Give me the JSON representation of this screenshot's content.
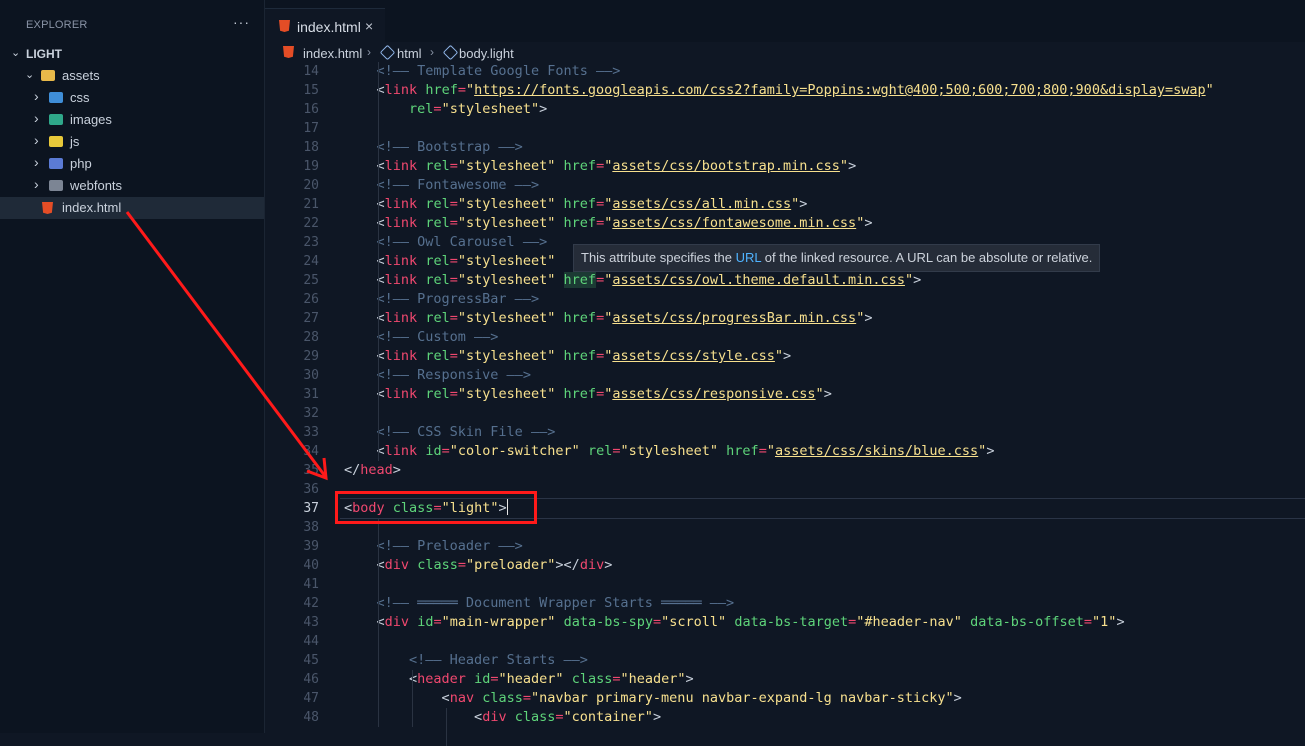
{
  "explorer": {
    "header": "EXPLORER",
    "more": "···",
    "root": "LIGHT",
    "items": [
      {
        "label": "assets",
        "type": "folder-open",
        "depth": 1,
        "chevron": "⌄"
      },
      {
        "label": "css",
        "type": "folder",
        "depth": 2,
        "chevron": "›"
      },
      {
        "label": "images",
        "type": "folder",
        "depth": 2,
        "chevron": "›"
      },
      {
        "label": "js",
        "type": "folder",
        "depth": 2,
        "chevron": "›"
      },
      {
        "label": "php",
        "type": "folder",
        "depth": 2,
        "chevron": "›"
      },
      {
        "label": "webfonts",
        "type": "folder",
        "depth": 2,
        "chevron": "›"
      },
      {
        "label": "index.html",
        "type": "html-file",
        "depth": 1,
        "selected": true
      }
    ]
  },
  "tab": {
    "title": "index.html",
    "close": "×"
  },
  "breadcrumb": {
    "file": "index.html",
    "sep": "›",
    "node1": "html",
    "node2": "body.light"
  },
  "tooltip": {
    "pre": "This attribute specifies the ",
    "link": "URL",
    "post": " of the linked resource. A URL can be absolute or relative."
  },
  "colors": {
    "annotation": "#ff1a1a",
    "background": "#0f1724",
    "tag": "#f0486f",
    "attr": "#5ed47a",
    "string": "#f7e08e",
    "comment": "#56708f"
  },
  "editor": {
    "active_line": 37,
    "lines": [
      {
        "n": "14",
        "t": "    <!—— Template Google Fonts ——>"
      },
      {
        "n": "15",
        "t": "    <link href=\"https://fonts.googleapis.com/css2?family=Poppins:wght@400;500;600;700;800;900&display=swap\""
      },
      {
        "n": "16",
        "t": "        rel=\"stylesheet\">"
      },
      {
        "n": "17",
        "t": ""
      },
      {
        "n": "18",
        "t": "    <!—— Bootstrap ——>"
      },
      {
        "n": "19",
        "t": "    <link rel=\"stylesheet\" href=\"assets/css/bootstrap.min.css\">"
      },
      {
        "n": "20",
        "t": "    <!—— Fontawesome ——>"
      },
      {
        "n": "21",
        "t": "    <link rel=\"stylesheet\" href=\"assets/css/all.min.css\">"
      },
      {
        "n": "22",
        "t": "    <link rel=\"stylesheet\" href=\"assets/css/fontawesome.min.css\">"
      },
      {
        "n": "23",
        "t": "    <!—— Owl Carousel ——>"
      },
      {
        "n": "24",
        "t": "    <link rel=\"stylesheet\""
      },
      {
        "n": "25",
        "t": "    <link rel=\"stylesheet\" href=\"assets/css/owl.theme.default.min.css\">"
      },
      {
        "n": "26",
        "t": "    <!—— ProgressBar ——>"
      },
      {
        "n": "27",
        "t": "    <link rel=\"stylesheet\" href=\"assets/css/progressBar.min.css\">"
      },
      {
        "n": "28",
        "t": "    <!—— Custom ——>"
      },
      {
        "n": "29",
        "t": "    <link rel=\"stylesheet\" href=\"assets/css/style.css\">"
      },
      {
        "n": "30",
        "t": "    <!—— Responsive ——>"
      },
      {
        "n": "31",
        "t": "    <link rel=\"stylesheet\" href=\"assets/css/responsive.css\">"
      },
      {
        "n": "32",
        "t": ""
      },
      {
        "n": "33",
        "t": "    <!—— CSS Skin File ——>"
      },
      {
        "n": "34",
        "t": "    <link id=\"color-switcher\" rel=\"stylesheet\" href=\"assets/css/skins/blue.css\">"
      },
      {
        "n": "35",
        "t": "</head>"
      },
      {
        "n": "36",
        "t": ""
      },
      {
        "n": "37",
        "t": "<body class=\"light\">"
      },
      {
        "n": "38",
        "t": ""
      },
      {
        "n": "39",
        "t": "    <!—— Preloader ——>"
      },
      {
        "n": "40",
        "t": "    <div class=\"preloader\"></div>"
      },
      {
        "n": "41",
        "t": ""
      },
      {
        "n": "42",
        "t": "    <!—— ═════ Document Wrapper Starts ═════ ——>"
      },
      {
        "n": "43",
        "t": "    <div id=\"main-wrapper\" data-bs-spy=\"scroll\" data-bs-target=\"#header-nav\" data-bs-offset=\"1\">"
      },
      {
        "n": "44",
        "t": ""
      },
      {
        "n": "45",
        "t": "        <!—— Header Starts ——>"
      },
      {
        "n": "46",
        "t": "        <header id=\"header\" class=\"header\">"
      },
      {
        "n": "47",
        "t": "            <nav class=\"navbar primary-menu navbar-expand-lg navbar-sticky\">"
      },
      {
        "n": "48",
        "t": "                <div class=\"container\">"
      }
    ]
  }
}
